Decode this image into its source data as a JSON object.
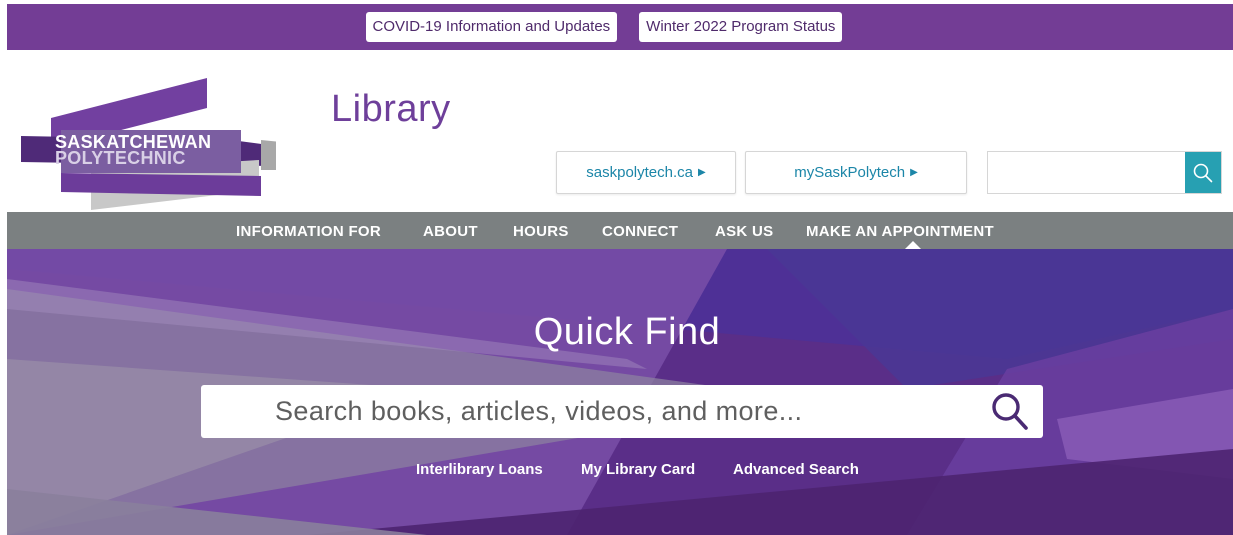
{
  "alert_bar": {
    "buttons": [
      "COVID-19 Information and Updates",
      "Winter 2022 Program Status"
    ]
  },
  "header": {
    "logo": {
      "line1": "SASKATCHEWAN",
      "line2": "POLYTECHNIC"
    },
    "title": "Library",
    "links": [
      {
        "label": "saskpolytech.ca"
      },
      {
        "label": "mySaskPolytech"
      }
    ],
    "search": {
      "placeholder": "",
      "value": ""
    },
    "link_arrow_icon": "triangle-right-icon",
    "search_icon": "search-icon"
  },
  "nav": {
    "items": [
      "INFORMATION FOR",
      "ABOUT",
      "HOURS",
      "CONNECT",
      "ASK US",
      "MAKE AN APPOINTMENT"
    ]
  },
  "hero": {
    "title": "Quick Find",
    "search_placeholder": "Search books, articles, videos, and more...",
    "links": [
      "Interlibrary Loans",
      "My Library Card",
      "Advanced Search"
    ]
  },
  "colors": {
    "brand_purple": "#733d95",
    "nav_gray": "#7b8081",
    "search_teal": "#27a0b2",
    "link_blue": "#1c86a8"
  }
}
